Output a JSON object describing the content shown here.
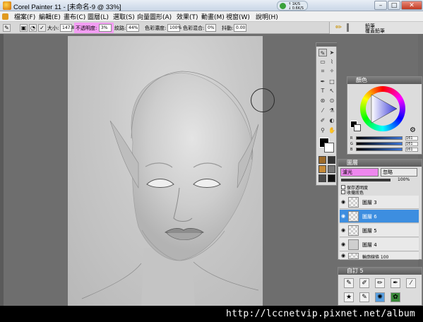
{
  "window": {
    "title": "Corel Painter 11 - [未命名-9 @ 33%]",
    "net_up": "↑ 1K/S",
    "net_down": "↓ 0.6K/S",
    "minimize": "–",
    "maximize": "□",
    "close": "✕"
  },
  "menu": [
    "檔案(F)",
    "編輯(E)",
    "畫布(C)",
    "圖層(L)",
    "選取(S)",
    "向量圖形(A)",
    "效果(T)",
    "動畫(M)",
    "視窗(W)",
    "說明(H)"
  ],
  "properties": {
    "size_label": "大小:",
    "size_value": "147.8",
    "opacity_label": "不透明度:",
    "opacity_value": "3%",
    "grain_label": "紋路:",
    "grain_value": "44%",
    "resat_label": "色彩濃度:",
    "resat_value": "100%",
    "bleed_label": "色彩混合:",
    "bleed_value": "0%",
    "jitter_label": "抖動:",
    "jitter_value": "0.00"
  },
  "brush_selector": {
    "category": "鉛筆",
    "variant": "覆蓋鉛筆"
  },
  "color_panel": {
    "title": "顏色",
    "r_label": "R",
    "g_label": "G",
    "b_label": "B",
    "r": "161",
    "g": "161",
    "b": "161"
  },
  "layers_panel": {
    "title": "圖層",
    "blend_mode": "濾光",
    "composite": "忽略",
    "preserve_transparency": "保存透明度",
    "pick_up": "收攏底色",
    "opacity_value": "100%",
    "layers": [
      {
        "name": "圖層 3",
        "selected": false
      },
      {
        "name": "圖層 6",
        "selected": true
      },
      {
        "name": "圖層 5",
        "selected": false
      },
      {
        "name": "圖層 4",
        "selected": false
      },
      {
        "name": "輪廓線條 100",
        "selected": false
      }
    ]
  },
  "custom_panel": {
    "title": "自訂 5"
  },
  "watermark": "http://lccnetvip.pixnet.net/album"
}
